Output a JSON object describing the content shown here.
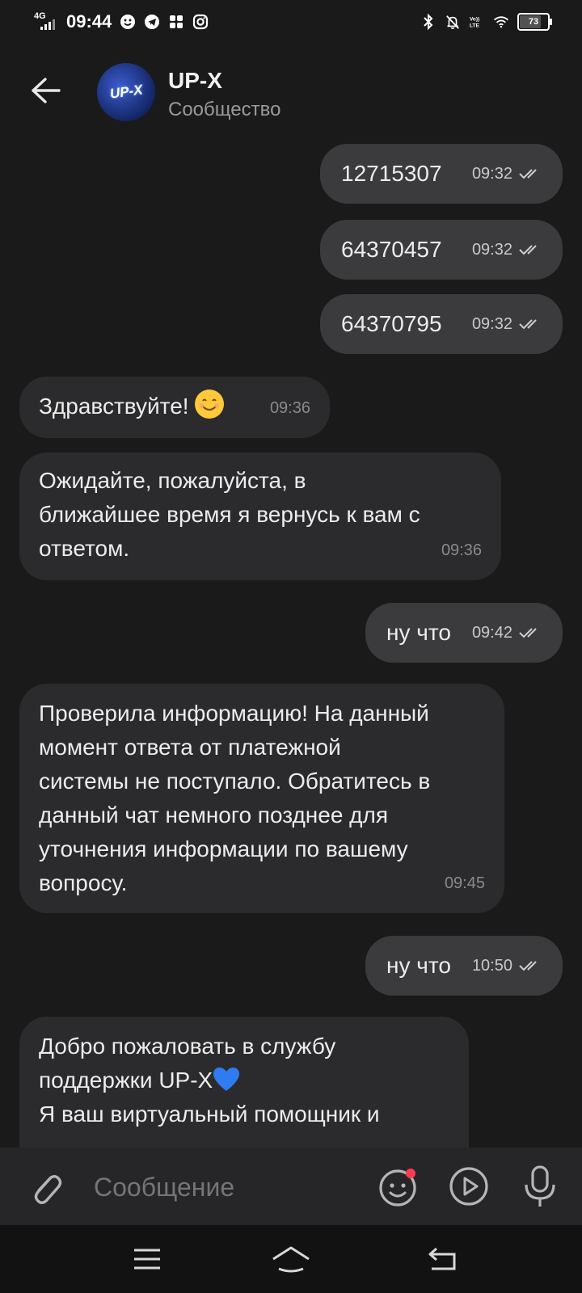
{
  "status_bar": {
    "network": "4G",
    "time": "09:44",
    "battery": "73"
  },
  "header": {
    "avatar_text": "UP-X",
    "title": "UP-X",
    "subtitle": "Сообщество"
  },
  "messages": [
    {
      "dir": "out",
      "text": "12715307",
      "time": "09:32"
    },
    {
      "dir": "out",
      "text": "64370457",
      "time": "09:32"
    },
    {
      "dir": "out",
      "text": "64370795",
      "time": "09:32"
    },
    {
      "dir": "in",
      "text": "Здравствуйте!",
      "time": "09:36"
    },
    {
      "dir": "in",
      "lines": [
        "Ожидайте, пожалуйста, в",
        "ближайшее время я вернусь к вам с",
        "ответом."
      ],
      "time": "09:36"
    },
    {
      "dir": "out",
      "text": "ну что",
      "time": "09:42"
    },
    {
      "dir": "in",
      "lines": [
        "Проверила информацию! На данный",
        "момент ответа от платежной",
        "системы не поступало. Обратитесь в",
        "данный чат немного позднее для",
        "уточнения информации по вашему",
        "вопросу."
      ],
      "time": "09:45"
    },
    {
      "dir": "out",
      "text": "ну что",
      "time": "10:50"
    },
    {
      "dir": "in",
      "lines": [
        "Добро пожаловать в службу",
        "поддержки UP-X",
        "Я ваш виртуальный помощник и"
      ]
    }
  ],
  "input": {
    "placeholder": "Сообщение"
  },
  "colors": {
    "background": "#1a1a1a",
    "outgoing_bubble": "#3b3b3d",
    "incoming_bubble": "#2b2b2d",
    "input_bar": "#262628",
    "badge": "#ff3b4e"
  }
}
